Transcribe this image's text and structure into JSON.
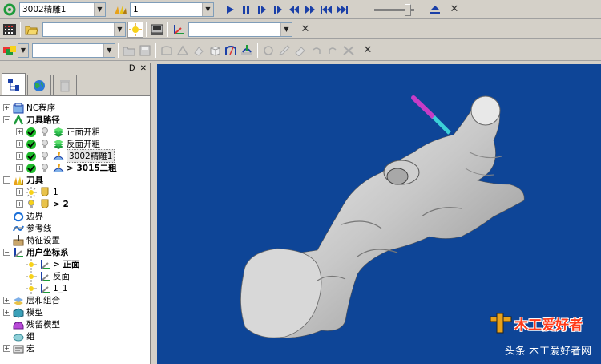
{
  "toolbar1": {
    "toolpath_select": "3002精雕1",
    "number_select": "1"
  },
  "tree": {
    "nc_program": "NC程序",
    "toolpaths": "刀具路径",
    "tp_items": [
      "正面开粗",
      "反面开粗",
      "3002精雕1",
      "> 3015二粗"
    ],
    "tools": "刀具",
    "tool_items": [
      "1",
      "> 2"
    ],
    "boundary": "边界",
    "reference_line": "参考线",
    "feature_set": "特征设置",
    "user_cs": "用户坐标系",
    "cs_items": [
      "> 正面",
      "反面",
      "1_1"
    ],
    "levels": "层和组合",
    "model": "模型",
    "stock_model": "残留模型",
    "group": "组",
    "macro": "宏"
  },
  "watermark": {
    "logo_text": "木工爱好者",
    "caption": "头条 木工爱好者网"
  }
}
